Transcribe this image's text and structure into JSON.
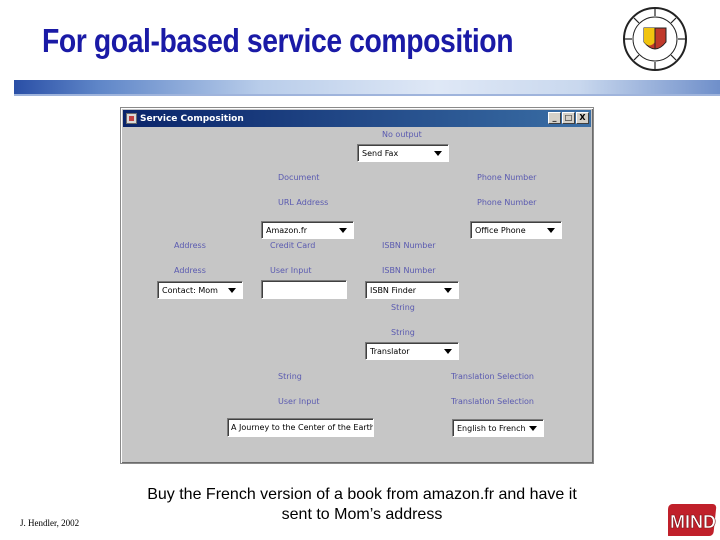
{
  "slide": {
    "title": "For goal-based service composition",
    "credit": "J. Hendler, 2002",
    "caption": "Buy the French version of a book from amazon.fr and have it sent to Mom’s address",
    "colors": {
      "title": "#1a1aa6",
      "label": "#5a5ab0",
      "titlebar": "#0a246a",
      "window_bg": "#c6c6c6"
    }
  },
  "window": {
    "title": "Service Composition",
    "buttons": {
      "minimize": "_",
      "maximize": "□",
      "close": "X"
    }
  },
  "form": {
    "no_output_label": "No output",
    "send_fax_combo": "Send Fax",
    "document_label": "Document",
    "phone_number_label_1": "Phone Number",
    "url_address_label": "URL Address",
    "phone_number_label_2": "Phone Number",
    "amazon_combo": "Amazon.fr",
    "office_phone_combo": "Office Phone",
    "address_label_1": "Address",
    "credit_card_label": "Credit Card",
    "isbn_label_1": "ISBN Number",
    "address_label_2": "Address",
    "user_input_label_1": "User Input",
    "isbn_label_2": "ISBN Number",
    "contact_combo": "Contact: Mom",
    "user_input_value": "",
    "isbn_finder_combo": "ISBN Finder",
    "string_label_1": "String",
    "string_label_2": "String",
    "translator_combo": "Translator",
    "string_label_3": "String",
    "translation_selection_label_1": "Translation Selection",
    "user_input_label_2": "User Input",
    "translation_selection_label_2": "Translation Selection",
    "book_title_value": "A Journey to the Center of the Earth",
    "english_to_french_combo": "English to French"
  },
  "icons": {
    "seal": "university-seal-icon",
    "logo": "mind-logo-icon",
    "app": "java-app-icon"
  },
  "logo_text": "MIND"
}
